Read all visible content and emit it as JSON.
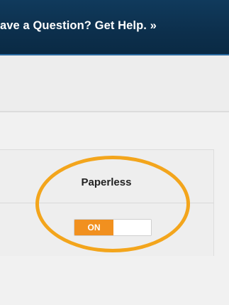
{
  "banner": {
    "help_text": "ave a Question? Get Help. »"
  },
  "settings": {
    "column_header": "Paperless",
    "toggle": {
      "state_label": "ON",
      "checked": true
    }
  },
  "colors": {
    "banner_background": "#0c2f4c",
    "toggle_on": "#f1901f",
    "highlight_ring": "#f3a51c"
  }
}
